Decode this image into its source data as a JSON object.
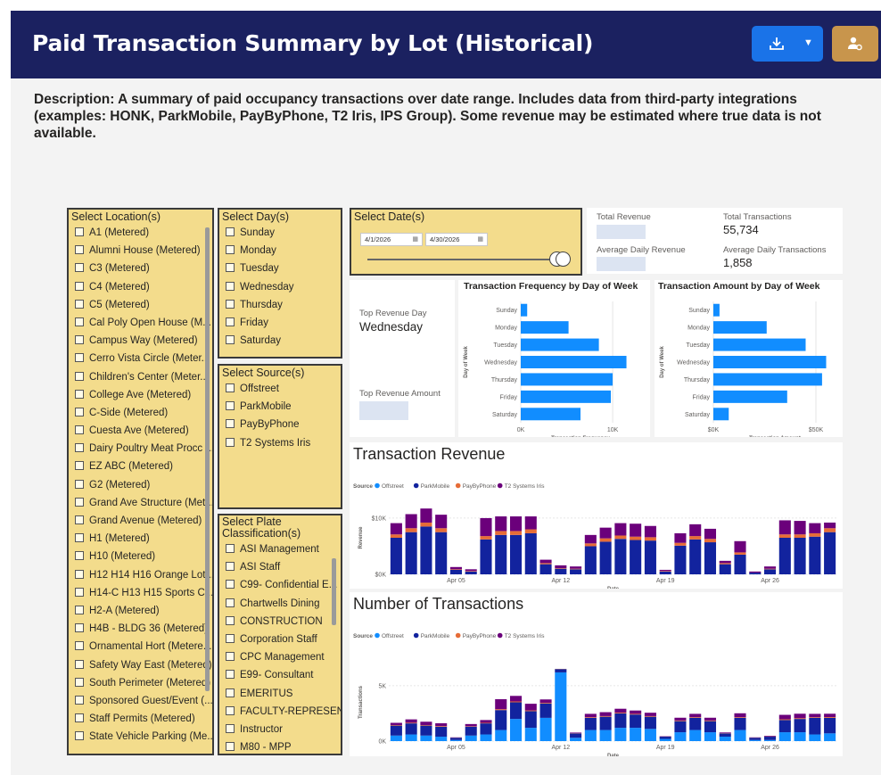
{
  "header": {
    "title": "Paid Transaction Summary by Lot (Historical)",
    "download_icon": "download-icon",
    "user_icon": "user-settings-icon"
  },
  "description": "Description: A summary of paid occupancy transactions over date range. Includes data from third-party integrations (examples: HONK, ParkMobile, PayByPhone, T2 Iris, IPS Group). Some revenue may be estimated where true data is not available.",
  "locations": {
    "title": "Select Location(s)",
    "items": [
      "A1 (Metered)",
      "Alumni House (Metered)",
      "C3 (Metered)",
      "C4 (Metered)",
      "C5 (Metered)",
      "Cal Poly Open House (M...",
      "Campus Way (Metered)",
      "Cerro Vista Circle (Meter...",
      "Children's Center (Meter...",
      "College Ave (Metered)",
      "C-Side (Metered)",
      "Cuesta Ave (Metered)",
      "Dairy Poultry Meat Procc ...",
      "EZ ABC (Metered)",
      "G2 (Metered)",
      "Grand Ave Structure (Met...",
      "Grand Avenue (Metered)",
      "H1 (Metered)",
      "H10 (Metered)",
      "H12 H14 H16 Orange Lot...",
      "H14-C H13 H15 Sports C...",
      "H2-A (Metered)",
      "H4B - BLDG 36 (Metered)",
      "Ornamental Hort (Metere...",
      "Safety Way East (Metered)",
      "South Perimeter (Metered)",
      "Sponsored Guest/Event (...",
      "Staff Permits (Metered)",
      "State Vehicle Parking (Me..."
    ]
  },
  "days": {
    "title": "Select Day(s)",
    "items": [
      "Sunday",
      "Monday",
      "Tuesday",
      "Wednesday",
      "Thursday",
      "Friday",
      "Saturday"
    ]
  },
  "sources": {
    "title": "Select Source(s)",
    "items": [
      "Offstreet",
      "ParkMobile",
      "PayByPhone",
      "T2 Systems Iris"
    ]
  },
  "plates": {
    "title": "Select Plate Classification(s)",
    "items": [
      "ASI Management",
      "ASI Staff",
      "C99- Confidential E...",
      "Chartwells Dining",
      "CONSTRUCTION",
      "Corporation Staff",
      "CPC Management",
      "E99- Consultant",
      "EMERITUS",
      "FACULTY-REPRESEN...",
      "Instructor",
      "M80 - MPP"
    ]
  },
  "dates": {
    "title": "Select Date(s)",
    "start": "4/1/2026",
    "end": "4/30/2026",
    "calendar_icon": "calendar-icon"
  },
  "kpis": {
    "total_revenue_label": "Total Revenue",
    "total_transactions_label": "Total Transactions",
    "total_transactions": "55,734",
    "avg_daily_revenue_label": "Average Daily Revenue",
    "avg_daily_transactions_label": "Average Daily Transactions",
    "avg_daily_transactions": "1,858",
    "top_revenue_day_label": "Top Revenue Day",
    "top_revenue_day": "Wednesday",
    "top_revenue_amount_label": "Top Revenue Amount"
  },
  "colors": {
    "Offstreet": "#118dff",
    "ParkMobile": "#12239e",
    "PayByPhone": "#e66c37",
    "T2 Systems Iris": "#6b007b",
    "slicer_bg": "#f3dc8c",
    "header_bg": "#1b2160"
  },
  "chart_data": [
    {
      "type": "bar",
      "title": "Transaction Frequency by Day of Week",
      "orientation": "horizontal",
      "categories": [
        "Sunday",
        "Monday",
        "Tuesday",
        "Wednesday",
        "Thursday",
        "Friday",
        "Saturday"
      ],
      "values": [
        700,
        5200,
        8500,
        11500,
        10000,
        9800,
        6500
      ],
      "xlabel": "Transaction Frequency",
      "ylabel": "Day of Week",
      "xticks": [
        "0K",
        "10K"
      ],
      "xlim": [
        0,
        13000
      ]
    },
    {
      "type": "bar",
      "title": "Transaction Amount by Day of Week",
      "orientation": "horizontal",
      "categories": [
        "Sunday",
        "Monday",
        "Tuesday",
        "Wednesday",
        "Thursday",
        "Friday",
        "Saturday"
      ],
      "values": [
        3000,
        26000,
        45000,
        55000,
        53000,
        36000,
        7500
      ],
      "xlabel": "Transaction Amount",
      "ylabel": "Day of Week",
      "xticks": [
        "$0K",
        "$50K"
      ],
      "xlim": [
        0,
        60000
      ]
    },
    {
      "type": "bar",
      "stacked": true,
      "title": "Transaction Revenue",
      "legend_title": "Source",
      "x_dates": [
        "2026-04-01",
        "2026-04-02",
        "2026-04-03",
        "2026-04-04",
        "2026-04-05",
        "2026-04-06",
        "2026-04-07",
        "2026-04-08",
        "2026-04-09",
        "2026-04-10",
        "2026-04-11",
        "2026-04-12",
        "2026-04-13",
        "2026-04-14",
        "2026-04-15",
        "2026-04-16",
        "2026-04-17",
        "2026-04-18",
        "2026-04-19",
        "2026-04-20",
        "2026-04-21",
        "2026-04-22",
        "2026-04-23",
        "2026-04-24",
        "2026-04-25",
        "2026-04-26",
        "2026-04-27",
        "2026-04-28",
        "2026-04-29",
        "2026-04-30"
      ],
      "xticks": [
        "Apr 05",
        "Apr 12",
        "Apr 19",
        "Apr 26"
      ],
      "yticks": [
        "$0K",
        "$10K"
      ],
      "xlabel": "Date",
      "ylabel": "Revenue",
      "ylim": [
        0,
        13000
      ],
      "series": [
        {
          "name": "Offstreet",
          "values": [
            0,
            0,
            0,
            0,
            0,
            0,
            0,
            0,
            0,
            0,
            0,
            0,
            0,
            0,
            0,
            0,
            0,
            0,
            0,
            0,
            0,
            0,
            0,
            0,
            0,
            0,
            0,
            0,
            0,
            0
          ]
        },
        {
          "name": "ParkMobile",
          "values": [
            6500,
            7500,
            8500,
            7500,
            800,
            500,
            6200,
            7000,
            7000,
            7300,
            1800,
            1000,
            900,
            5000,
            5800,
            6300,
            6100,
            6000,
            500,
            5100,
            6200,
            5700,
            1800,
            3500,
            300,
            900,
            6500,
            6500,
            6700,
            7500
          ]
        },
        {
          "name": "PayByPhone",
          "values": [
            600,
            700,
            700,
            700,
            100,
            100,
            600,
            700,
            700,
            700,
            200,
            100,
            100,
            500,
            600,
            600,
            600,
            600,
            100,
            500,
            600,
            600,
            200,
            400,
            0,
            100,
            600,
            600,
            600,
            700
          ]
        },
        {
          "name": "T2 Systems Iris",
          "values": [
            2000,
            2500,
            2500,
            2400,
            400,
            300,
            3200,
            2600,
            2600,
            2300,
            600,
            500,
            400,
            1500,
            1900,
            2200,
            2300,
            2000,
            200,
            1700,
            2100,
            1800,
            400,
            2000,
            200,
            400,
            2500,
            2400,
            1800,
            1000
          ]
        }
      ]
    },
    {
      "type": "bar",
      "stacked": true,
      "title": "Number of Transactions",
      "legend_title": "Source",
      "x_dates": [
        "2026-04-01",
        "2026-04-02",
        "2026-04-03",
        "2026-04-04",
        "2026-04-05",
        "2026-04-06",
        "2026-04-07",
        "2026-04-08",
        "2026-04-09",
        "2026-04-10",
        "2026-04-11",
        "2026-04-12",
        "2026-04-13",
        "2026-04-14",
        "2026-04-15",
        "2026-04-16",
        "2026-04-17",
        "2026-04-18",
        "2026-04-19",
        "2026-04-20",
        "2026-04-21",
        "2026-04-22",
        "2026-04-23",
        "2026-04-24",
        "2026-04-25",
        "2026-04-26",
        "2026-04-27",
        "2026-04-28",
        "2026-04-29",
        "2026-04-30"
      ],
      "xticks": [
        "Apr 05",
        "Apr 12",
        "Apr 19",
        "Apr 26"
      ],
      "yticks": [
        "0K",
        "5K"
      ],
      "xlabel": "Date",
      "ylabel": "Transactions",
      "ylim": [
        0,
        7000
      ],
      "series": [
        {
          "name": "Offstreet",
          "values": [
            500,
            600,
            500,
            400,
            100,
            500,
            600,
            1000,
            2000,
            1200,
            2100,
            6200,
            300,
            1000,
            1000,
            1200,
            1200,
            1100,
            200,
            800,
            1000,
            800,
            400,
            1000,
            100,
            100,
            800,
            800,
            600,
            700
          ]
        },
        {
          "name": "ParkMobile",
          "values": [
            900,
            1000,
            900,
            900,
            200,
            800,
            1000,
            1800,
            1500,
            1500,
            1300,
            300,
            400,
            1100,
            1200,
            1300,
            1200,
            1100,
            200,
            1000,
            1100,
            1000,
            300,
            1100,
            200,
            300,
            1100,
            1200,
            1500,
            1400
          ]
        },
        {
          "name": "PayByPhone",
          "values": [
            50,
            60,
            50,
            60,
            10,
            40,
            50,
            80,
            80,
            70,
            60,
            20,
            20,
            60,
            60,
            70,
            60,
            60,
            10,
            60,
            60,
            60,
            20,
            60,
            10,
            20,
            70,
            70,
            60,
            70
          ]
        },
        {
          "name": "T2 Systems Iris",
          "values": [
            200,
            300,
            300,
            250,
            30,
            200,
            250,
            900,
            500,
            600,
            300,
            0,
            50,
            300,
            350,
            350,
            300,
            300,
            30,
            250,
            300,
            250,
            60,
            350,
            30,
            60,
            400,
            400,
            300,
            300
          ]
        }
      ]
    }
  ]
}
